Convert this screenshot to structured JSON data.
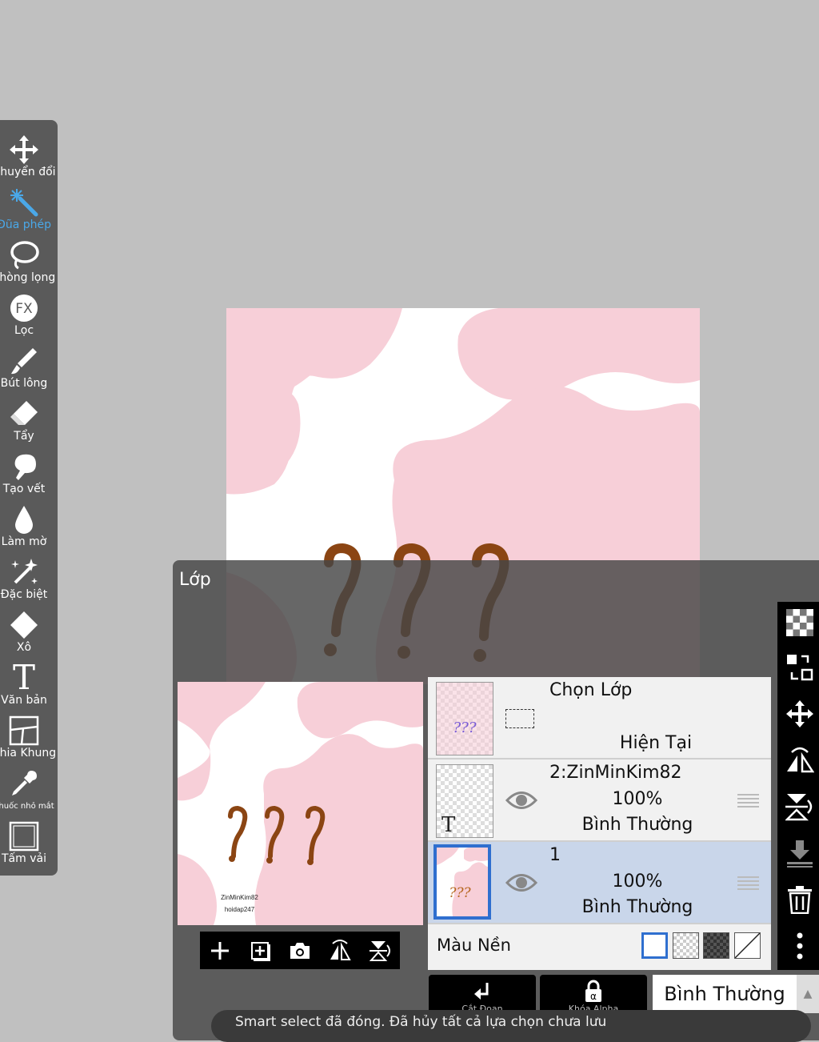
{
  "toolbar": {
    "tools": [
      {
        "label": "Chuyển đổi",
        "icon": "move-arrows-icon"
      },
      {
        "label": "Đũa phép",
        "icon": "magic-wand-icon",
        "active": true
      },
      {
        "label": "Thòng lọng",
        "icon": "lasso-icon"
      },
      {
        "label": "Lọc",
        "icon": "fx-filter-icon",
        "badge": "FX"
      },
      {
        "label": "Bút lông",
        "icon": "brush-icon"
      },
      {
        "label": "Tẩy",
        "icon": "eraser-icon"
      },
      {
        "label": "Tạo vết",
        "icon": "smudge-icon"
      },
      {
        "label": "Làm mờ",
        "icon": "blur-drop-icon"
      },
      {
        "label": "Đặc biệt",
        "icon": "special-sparkle-icon"
      },
      {
        "label": "Xô",
        "icon": "bucket-icon"
      },
      {
        "label": "Văn bản",
        "icon": "text-tool-icon",
        "glyph": "T"
      },
      {
        "label": "Chia Khung",
        "icon": "frame-divider-icon"
      },
      {
        "label": "Thuốc nhỏ mắt",
        "icon": "eyedropper-icon"
      },
      {
        "label": "Tấm vải",
        "icon": "canvas-icon"
      }
    ],
    "active_color": "#4aa8e8"
  },
  "layer_panel": {
    "title": "Lớp",
    "preview_watermark": [
      "ZinMinKim82",
      "hoidap247"
    ],
    "layers": [
      {
        "name": "Chọn Lớp",
        "status": "Hiện Tại",
        "kind": "selection"
      },
      {
        "name": "2:ZinMinKim82",
        "opacity": "100%",
        "blend": "Bình Thường",
        "kind": "text",
        "thumb_glyph": "T"
      },
      {
        "name": "1",
        "opacity": "100%",
        "blend": "Bình Thường",
        "kind": "image",
        "selected": true
      }
    ],
    "background": {
      "label": "Màu Nền"
    },
    "bottom_buttons": [
      {
        "label": "Cắt Đoạn",
        "icon": "clip-arrow-icon"
      },
      {
        "label": "Khóa Alpha",
        "icon": "alpha-lock-icon",
        "badge": "α"
      }
    ],
    "blend_mode": "Bình Thường",
    "blend_arrow": "▲"
  },
  "toast": "Smart select đã đóng. Đã hủy tất cả lựa chọn chưa lưu",
  "colors": {
    "pink": "#f7cfd8",
    "question_mark": "#8b4513",
    "selection_blue": "#2f6fcf"
  }
}
